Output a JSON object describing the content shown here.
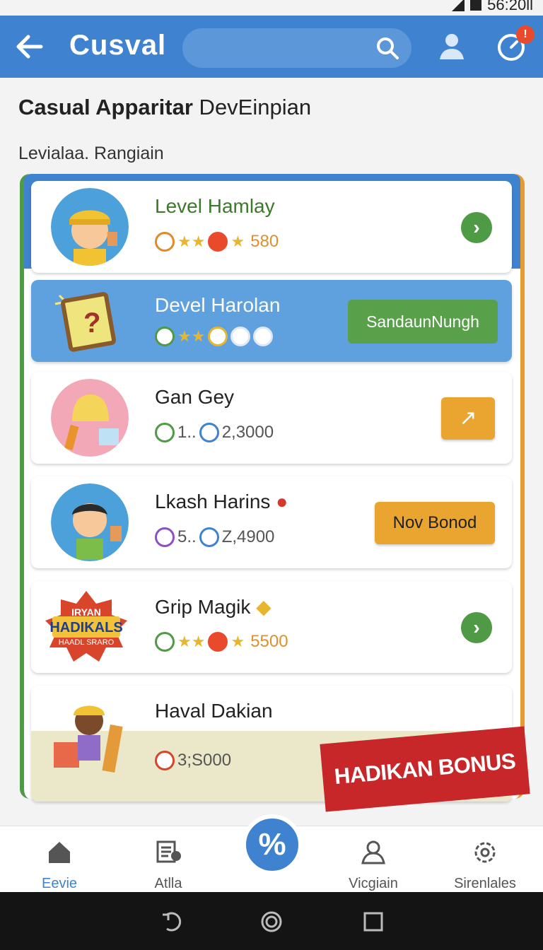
{
  "status": {
    "time": "56:20ll"
  },
  "appbar": {
    "title": "Cusval",
    "badge": "!"
  },
  "heading": {
    "bold": "Casual Apparitar",
    "thin": " DevЕinpian"
  },
  "subheading": "Levialaa. Rangiain",
  "cards": [
    {
      "name": "Level Hamlay",
      "stats": "580"
    },
    {
      "name": "Devel Harolan",
      "button": "SandaunNungh"
    },
    {
      "name": "Gan Gey",
      "stat1": "1..",
      "stat2": "2,3000"
    },
    {
      "name": "Lkash Harins",
      "stat1": "5..",
      "stat2": "Z,4900",
      "button": "Nov Bonod"
    },
    {
      "name": "Grip Magik",
      "stats": "5500",
      "logo_text": "IRYAN HADIKALS HAADL SRARO"
    },
    {
      "name": "Haval Dakian",
      "stats": "3;S000"
    }
  ],
  "bonus": "HADIKAN BONUS",
  "nav": [
    {
      "label": "Eevie",
      "icon": "home-icon"
    },
    {
      "label": "Atlla",
      "icon": "list-icon"
    },
    {
      "label": "%",
      "icon": "percent-icon"
    },
    {
      "label": "Vicgiain",
      "icon": "person-icon"
    },
    {
      "label": "Sirenlales",
      "icon": "gear-icon"
    }
  ],
  "colors": {
    "primary": "#3f83d0",
    "green": "#4f9a45",
    "orange": "#e9a530",
    "red": "#c8272a"
  }
}
